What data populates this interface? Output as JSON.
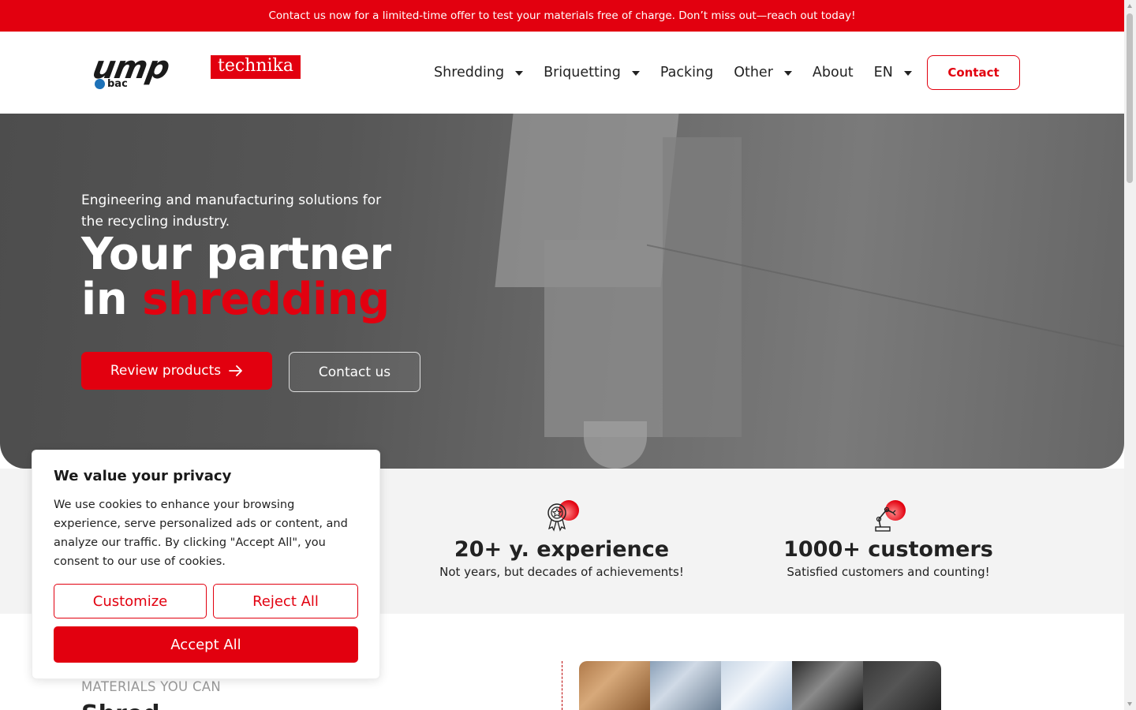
{
  "promo": {
    "text": "Contact us now for a limited-time offer to test your materials free of charge. Don’t miss out—reach out today!"
  },
  "logo": {
    "ump": "ump",
    "technika": "technika",
    "bac": "bac"
  },
  "nav": {
    "items": [
      {
        "label": "Shredding",
        "has_caret": true
      },
      {
        "label": "Briquetting",
        "has_caret": true
      },
      {
        "label": "Packing",
        "has_caret": false
      },
      {
        "label": "Other",
        "has_caret": true
      },
      {
        "label": "About",
        "has_caret": false
      },
      {
        "label": "EN",
        "has_caret": true
      }
    ],
    "contact_label": "Contact"
  },
  "hero": {
    "subtitle": "Engineering and manufacturing solutions for the recycling industry.",
    "headline_line1": "Your partner",
    "headline_in": "in",
    "headline_highlight": "shredding",
    "primary_button": "Review products",
    "primary_icon": "arrow-right-icon",
    "secondary_button": "Contact us"
  },
  "stats": [
    {
      "icon": "award-medal-icon",
      "value": "20+ y. experience",
      "desc": "Not years, but decades of achievements!"
    },
    {
      "icon": "robot-arm-icon",
      "value": "1000+ customers",
      "desc": "Satisfied customers and counting!"
    }
  ],
  "materials": {
    "kicker": "MATERIALS YOU CAN",
    "heading": "Shred",
    "swatches": [
      "#b07a4a",
      "#8aa0b8",
      "#c9d7e6",
      "#2b2b2b",
      "#3a3a3a"
    ]
  },
  "cookie": {
    "title": "We value your privacy",
    "text": "We use cookies to enhance your browsing experience, serve personalized ads or content, and analyze our traffic. By clicking \"Accept All\", you consent to our use of cookies.",
    "customize": "Customize",
    "reject": "Reject All",
    "accept": "Accept All"
  },
  "colors": {
    "brand_red": "#e2000f",
    "hero_gray": "#5a5a5a",
    "stats_bg": "#f3f3f3"
  }
}
